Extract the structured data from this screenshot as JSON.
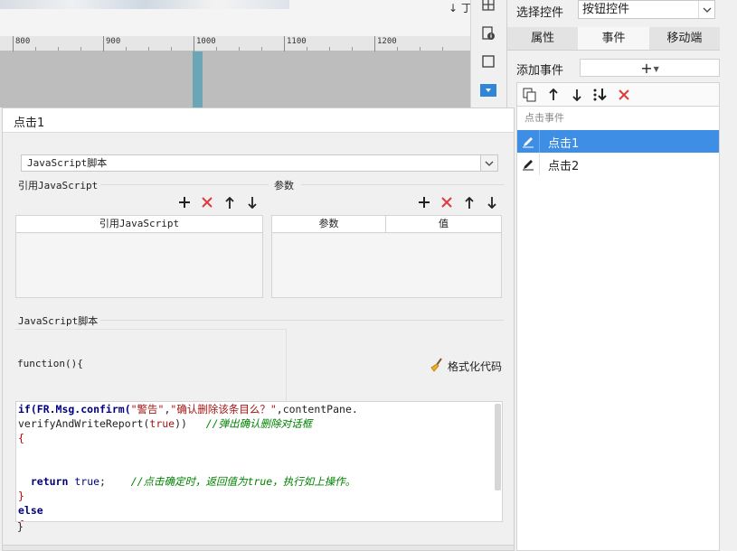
{
  "background": {
    "top_fragment": "↓ 丁川",
    "ruler_ticks": [
      "800",
      "900",
      "1000",
      "1100",
      "1200"
    ]
  },
  "right_panel": {
    "select_control_label": "选择控件",
    "select_control_value": "按钮控件",
    "tabs": [
      {
        "label": "属性",
        "active": false
      },
      {
        "label": "事件",
        "active": true
      },
      {
        "label": "移动端",
        "active": false
      }
    ],
    "add_event_label": "添加事件",
    "add_event_icon": "+",
    "event_section": "点击事件",
    "events": [
      {
        "label": "点击1",
        "selected": true
      },
      {
        "label": "点击2",
        "selected": false
      }
    ]
  },
  "pane": {
    "title": "点击1",
    "type_value": "JavaScript脚本",
    "ref_js_title": "引用JavaScript",
    "params_title": "参数",
    "ref_table_header": "引用JavaScript",
    "param_table_headers": [
      "参数",
      "值"
    ],
    "script_title": "JavaScript脚本",
    "function_line": "function(){",
    "format_button": "格式化代码",
    "closing_brace": "}",
    "code": {
      "line1_a": "if(FR.Msg.confirm(",
      "line1_str1": "\"警告\"",
      "line1_comma": ",",
      "line1_str2": "\"确认删除该条目么？\"",
      "line1_b": ",contentPane.",
      "line2_a": "verifyAndWriteReport(",
      "line2_true": "true",
      "line2_b": "))",
      "line2_comment": "//弹出确认删除对话框",
      "line3": "{",
      "line6_kw": "return",
      "line6_true": "true",
      "line6_semi": ";",
      "line6_comment": "//点击确定时，返回值为true，执行如上操作。",
      "line7": "}",
      "line8": "else",
      "line9": "{"
    }
  },
  "colors": {
    "selection": "#3d8ee4",
    "delete_red": "#e03a3a",
    "accent_col": "#6aa6b5"
  }
}
